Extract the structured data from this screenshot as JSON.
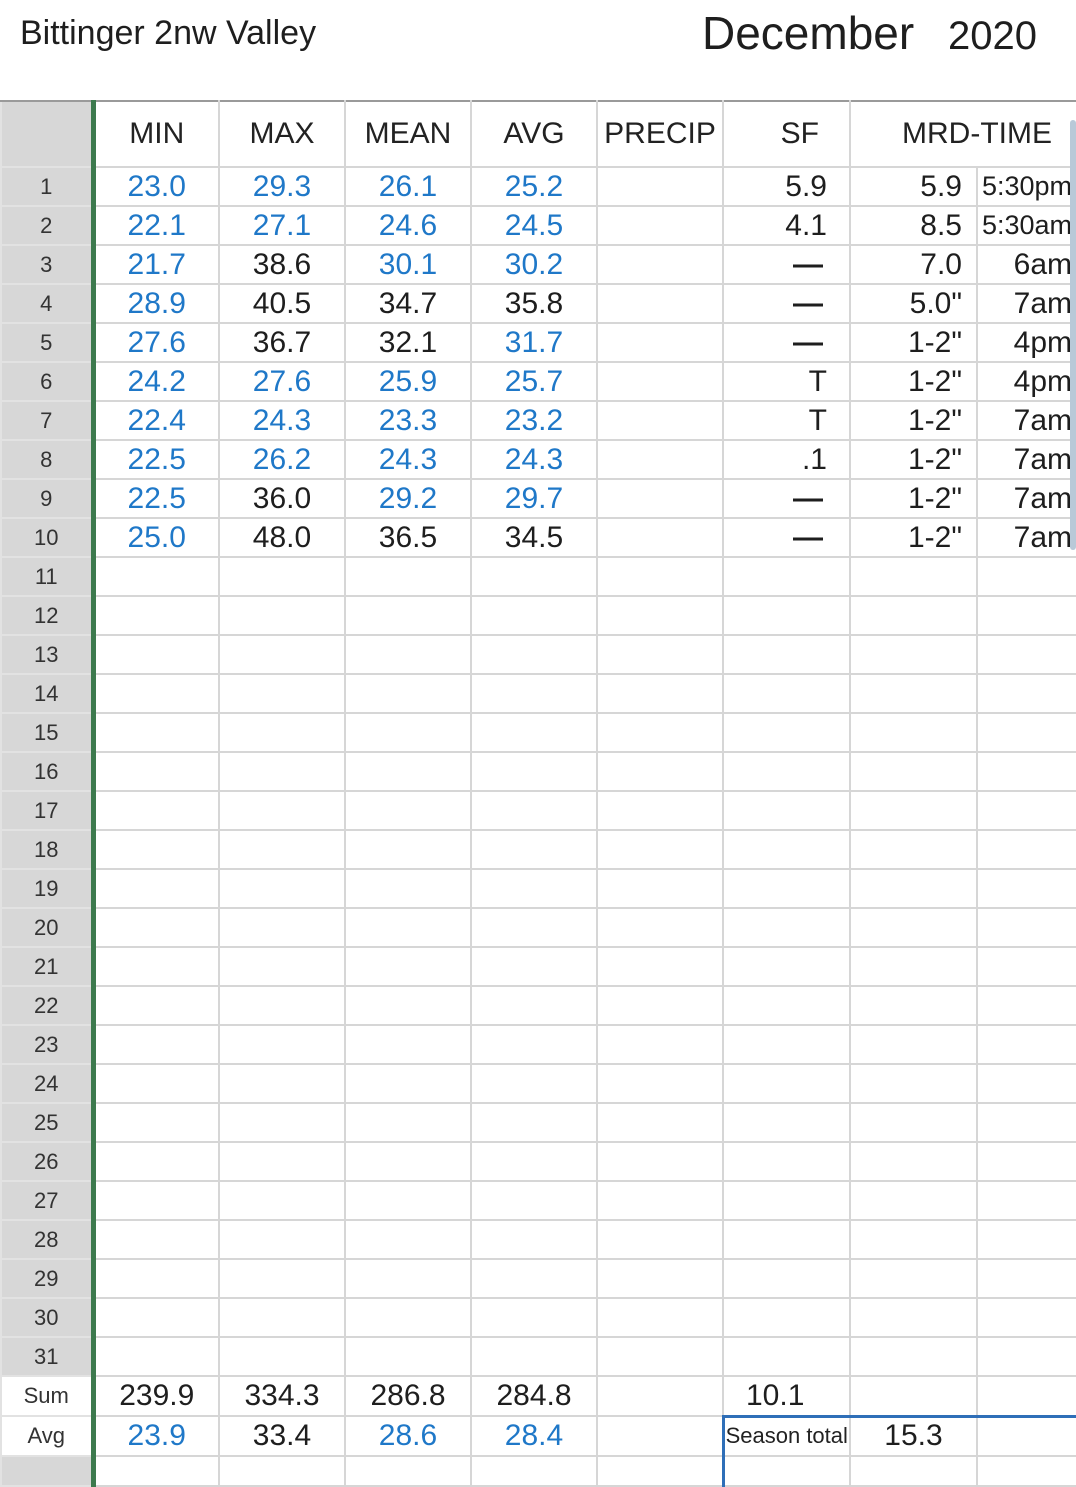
{
  "header": {
    "station": "Bittinger 2nw Valley",
    "month": "December",
    "year": "2020"
  },
  "columns": [
    "MIN",
    "MAX",
    "MEAN",
    "AVG",
    "PRECIP",
    "SF",
    "MRD-TIME"
  ],
  "rows": [
    {
      "day": "1",
      "min": "23.0",
      "max": "29.3",
      "mean": "26.1",
      "avg": "25.2",
      "precip": "",
      "sf": "5.9",
      "mrd": "5.9",
      "time": "5:30pm"
    },
    {
      "day": "2",
      "min": "22.1",
      "max": "27.1",
      "mean": "24.6",
      "avg": "24.5",
      "precip": "",
      "sf": "4.1",
      "mrd": "8.5",
      "time": "5:30am"
    },
    {
      "day": "3",
      "min": "21.7",
      "max": "38.6",
      "mean": "30.1",
      "avg": "30.2",
      "precip": "",
      "sf": "—",
      "mrd": "7.0",
      "time": "6am"
    },
    {
      "day": "4",
      "min": "28.9",
      "max": "40.5",
      "mean": "34.7",
      "avg": "35.8",
      "precip": "",
      "sf": "—",
      "mrd": "5.0\"",
      "time": "7am"
    },
    {
      "day": "5",
      "min": "27.6",
      "max": "36.7",
      "mean": "32.1",
      "avg": "31.7",
      "precip": "",
      "sf": "—",
      "mrd": "1-2\"",
      "time": "4pm"
    },
    {
      "day": "6",
      "min": "24.2",
      "max": "27.6",
      "mean": "25.9",
      "avg": "25.7",
      "precip": "",
      "sf": "T",
      "mrd": "1-2\"",
      "time": "4pm"
    },
    {
      "day": "7",
      "min": "22.4",
      "max": "24.3",
      "mean": "23.3",
      "avg": "23.2",
      "precip": "",
      "sf": "T",
      "mrd": "1-2\"",
      "time": "7am"
    },
    {
      "day": "8",
      "min": "22.5",
      "max": "26.2",
      "mean": "24.3",
      "avg": "24.3",
      "precip": "",
      "sf": ".1",
      "mrd": "1-2\"",
      "time": "7am"
    },
    {
      "day": "9",
      "min": "22.5",
      "max": "36.0",
      "mean": "29.2",
      "avg": "29.7",
      "precip": "",
      "sf": "—",
      "mrd": "1-2\"",
      "time": "7am"
    },
    {
      "day": "10",
      "min": "25.0",
      "max": "48.0",
      "mean": "36.5",
      "avg": "34.5",
      "precip": "",
      "sf": "—",
      "mrd": "1-2\"",
      "time": "7am"
    }
  ],
  "empty_days": [
    "11",
    "12",
    "13",
    "14",
    "15",
    "16",
    "17",
    "18",
    "19",
    "20",
    "21",
    "22",
    "23",
    "24",
    "25",
    "26",
    "27",
    "28",
    "29",
    "30",
    "31"
  ],
  "sum": {
    "label": "Sum",
    "min": "239.9",
    "max": "334.3",
    "mean": "286.8",
    "avg": "284.8",
    "sf": "10.1"
  },
  "avg": {
    "label": "Avg",
    "min": "23.9",
    "max": "33.4",
    "mean": "28.6",
    "avg": "28.4",
    "season_label": "Season total",
    "season_value": "15.3"
  },
  "colors": {
    "blue_text": "#1f78c8",
    "black_text": "#1e1e1e",
    "row_header_bg": "#d7d7d7",
    "freeze_line": "#3d7a4e",
    "selection": "#2f6fb8"
  },
  "value_colors": {
    "min": [
      "blue",
      "blue",
      "blue",
      "blue",
      "blue",
      "blue",
      "blue",
      "blue",
      "blue",
      "blue"
    ],
    "max": [
      "blue",
      "blue",
      "black",
      "black",
      "black",
      "blue",
      "blue",
      "blue",
      "black",
      "black"
    ],
    "mean": [
      "blue",
      "blue",
      "blue",
      "black",
      "black",
      "blue",
      "blue",
      "blue",
      "blue",
      "black"
    ],
    "avg": [
      "blue",
      "blue",
      "blue",
      "black",
      "blue",
      "blue",
      "blue",
      "blue",
      "blue",
      "black"
    ]
  }
}
